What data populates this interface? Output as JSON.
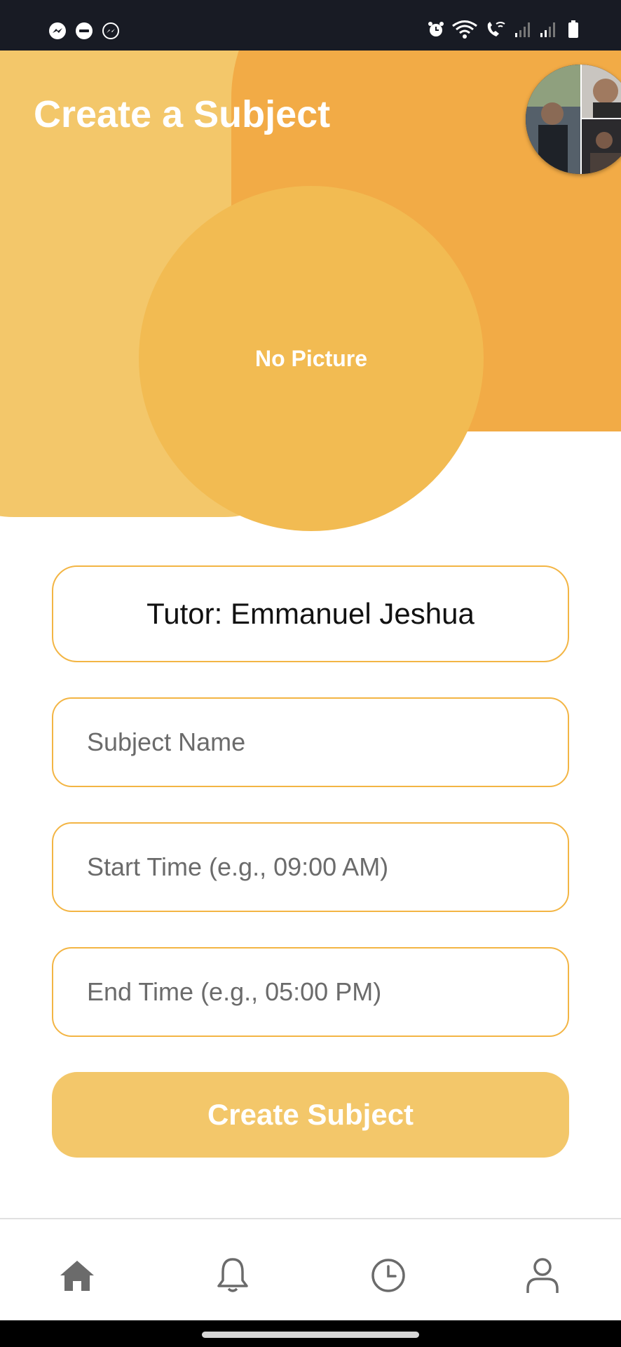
{
  "header": {
    "title": "Create a Subject",
    "photo_placeholder": "No Picture"
  },
  "form": {
    "tutor_label": "Tutor: Emmanuel Jeshua",
    "subject_name_placeholder": "Subject Name",
    "start_time_placeholder": "Start Time (e.g., 09:00 AM)",
    "end_time_placeholder": "End Time (e.g., 05:00 PM)",
    "submit_label": "Create Subject"
  },
  "status_bar": {
    "left_icons": [
      "messenger-icon",
      "do-not-disturb-icon",
      "messenger-icon"
    ],
    "right_icons": [
      "alarm-icon",
      "wifi-icon",
      "wifi-call-icon",
      "signal-icon",
      "signal-icon",
      "battery-icon"
    ]
  },
  "nav": {
    "items": [
      "home-icon",
      "bell-icon",
      "clock-icon",
      "user-icon"
    ]
  },
  "colors": {
    "accent": "#f3b544",
    "header_light": "#f3c76a",
    "header_dark": "#f2ab46",
    "button": "#f3c76a"
  }
}
